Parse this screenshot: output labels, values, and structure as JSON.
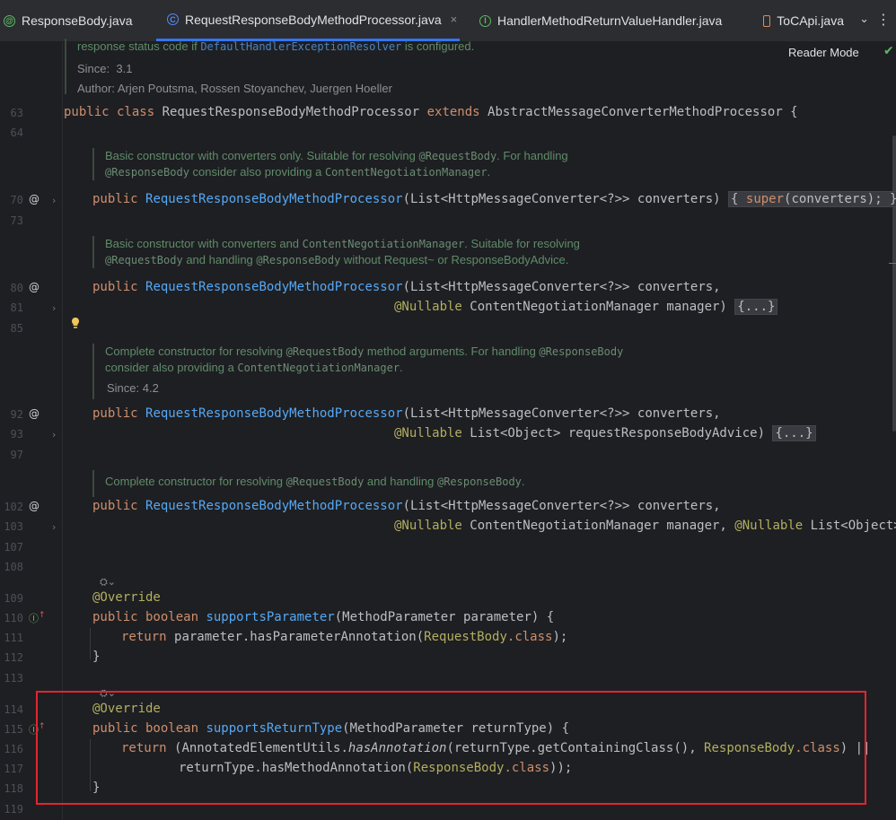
{
  "tabs": [
    {
      "label": "ResponseBody.java",
      "icon": "annotation-icon",
      "color": "#5fb865"
    },
    {
      "label": "RequestResponseBodyMethodProcessor.java",
      "icon": "class-icon",
      "color": "#3574f0"
    },
    {
      "label": "HandlerMethodReturnValueHandler.java",
      "icon": "interface-icon",
      "color": "#5fb865"
    },
    {
      "label": "ToCApi.java",
      "icon": "class-icon",
      "color": "#d98e5b"
    }
  ],
  "reader_mode": "Reader Mode",
  "header_doc": {
    "line1_prefix": "response status code if ",
    "line1_link": "DefaultHandlerExceptionResolver",
    "line1_suffix": " is configured.",
    "since_label": "Since:",
    "since_value": "3.1",
    "author_label": "Author:",
    "author_value": "Arjen Poutsma, Rossen Stoyanchev, Juergen Hoeller"
  },
  "line_numbers": [
    "63",
    "64",
    "70",
    "73",
    "80",
    "81",
    "85",
    "92",
    "93",
    "97",
    "102",
    "103",
    "107",
    "108",
    "109",
    "110",
    "111",
    "112",
    "113",
    "114",
    "115",
    "116",
    "117",
    "118",
    "119"
  ],
  "code": {
    "l63": {
      "kw1": "public class ",
      "name": "RequestResponseBodyMethodProcessor ",
      "kw2": "extends ",
      "rest": "AbstractMessageConverterMethodProcessor {"
    },
    "ctor_kw": "public ",
    "ctor_name": "RequestResponseBodyMethodProcessor",
    "l70_args": "(List<HttpMessageConverter<?>> converters) ",
    "l70_body_open": "{ ",
    "l70_super": "super",
    "l70_body_rest": "(converters); }",
    "l80_args": "(List<HttpMessageConverter<?>> converters,",
    "nullable": "@Nullable",
    "l81_rest": " ContentNegotiationManager manager) ",
    "fold": "{...}",
    "l93_rest": " List<Object> requestResponseBodyAdvice) ",
    "l103_mid": " ContentNegotiationManager manager, ",
    "l103_rest": " List<Object> re",
    "override": "@Override",
    "public_boolean": "public boolean ",
    "l110_name": "supportsParameter",
    "l110_rest": "(MethodParameter parameter) {",
    "return_kw": "return ",
    "l111_rest1": "parameter.hasParameterAnnotation(",
    "request_body": "RequestBody",
    "dot_class": ".class",
    "l111_end": ");",
    "close_brace": "}",
    "l115_name": "supportsReturnType",
    "l115_rest": "(MethodParameter returnType) {",
    "l116_a": "(AnnotatedElementUtils.",
    "l116_has": "hasAnnotation",
    "l116_b": "(returnType.getContainingClass(), ",
    "response_body": "ResponseBody",
    "l116_end": ") ||",
    "l117_a": "returnType.hasMethodAnnotation(",
    "l117_end": "));"
  },
  "docs": {
    "d1": {
      "t1": "Basic constructor with converters only. Suitable for resolving ",
      "m1": "@RequestBody",
      "t2": ". For handling",
      "m2": "@ResponseBody",
      "t3": " consider also providing a ",
      "m3": "ContentNegotiationManager",
      "t4": "."
    },
    "d2": {
      "t1": "Basic constructor with converters and ",
      "m1": "ContentNegotiationManager",
      "t2": ". Suitable for resolving",
      "m2": "@RequestBody",
      "t3": " and handling ",
      "m3": "@ResponseBody",
      "t4": " without Request~ or ResponseBodyAdvice."
    },
    "d3": {
      "t1": "Complete constructor for resolving ",
      "m1": "@RequestBody",
      "t2": " method arguments. For handling ",
      "m2": "@ResponseBody",
      "t3": "consider also providing a ",
      "m3": "ContentNegotiationManager",
      "t4": ".",
      "since_label": "Since:",
      "since_value": "4.2"
    },
    "d4": {
      "t1": "Complete constructor for resolving ",
      "m1": "@RequestBody",
      "t2": " and handling ",
      "m2": "@ResponseBody",
      "t3": "."
    }
  }
}
